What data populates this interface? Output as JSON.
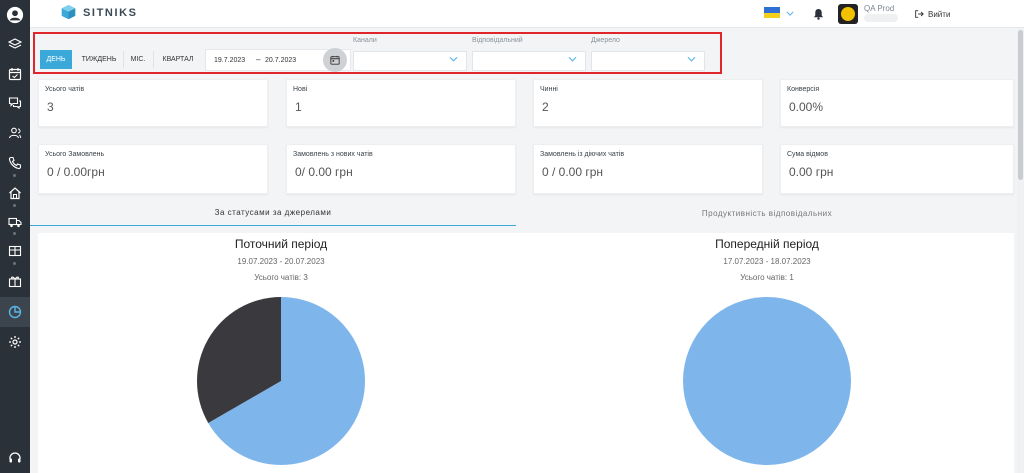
{
  "app": {
    "logo_text": "SITNIKS"
  },
  "header": {
    "user_name": "QA Prod",
    "logout_label": "Вийти"
  },
  "filters": {
    "periods": [
      "ДЕНЬ",
      "ТИЖДЕНЬ",
      "МІС.",
      "КВАРТАЛ"
    ],
    "active_period": "ДЕНЬ",
    "date_from": "19.7.2023",
    "date_sep": "–",
    "date_to": "20.7.2023",
    "channels_label": "Канали",
    "responsible_label": "Відповідальний",
    "source_label": "Джерело"
  },
  "stats": [
    {
      "label": "Усього чатів",
      "value": "3"
    },
    {
      "label": "Нові",
      "value": "1"
    },
    {
      "label": "Чинні",
      "value": "2"
    },
    {
      "label": "Конверсія",
      "value": "0.00%"
    },
    {
      "label": "Усього Замовлень",
      "value": "0 / 0.00грн"
    },
    {
      "label": "Замовлень з нових чатів",
      "value": "0/ 0.00 грн"
    },
    {
      "label": "Замовлень із діючих чатів",
      "value": "0 / 0.00 грн"
    },
    {
      "label": "Сума відмов",
      "value": "0.00 грн"
    }
  ],
  "tabs": [
    {
      "label": "За статусами за джерелами",
      "active": true
    },
    {
      "label": "Продуктивність відповідальних",
      "active": false
    }
  ],
  "current": {
    "title": "Поточний період",
    "range": "19.07.2023 - 20.07.2023",
    "count": "Усього чатів: 3"
  },
  "previous": {
    "title": "Попередній період",
    "range": "17.07.2023 - 18.07.2023",
    "count": "Усього чатів: 1"
  },
  "chart_data": [
    {
      "type": "pie",
      "title": "Поточний період",
      "values": [
        2,
        1
      ],
      "colors": [
        "#7eb6ec",
        "#3a3a3e"
      ]
    },
    {
      "type": "pie",
      "title": "Попередній період",
      "values": [
        1
      ],
      "colors": [
        "#7eb6ec"
      ]
    }
  ],
  "colors": {
    "accent": "#3aa8d8",
    "sidebar": "#2b3138",
    "highlight": "#e0262a"
  }
}
